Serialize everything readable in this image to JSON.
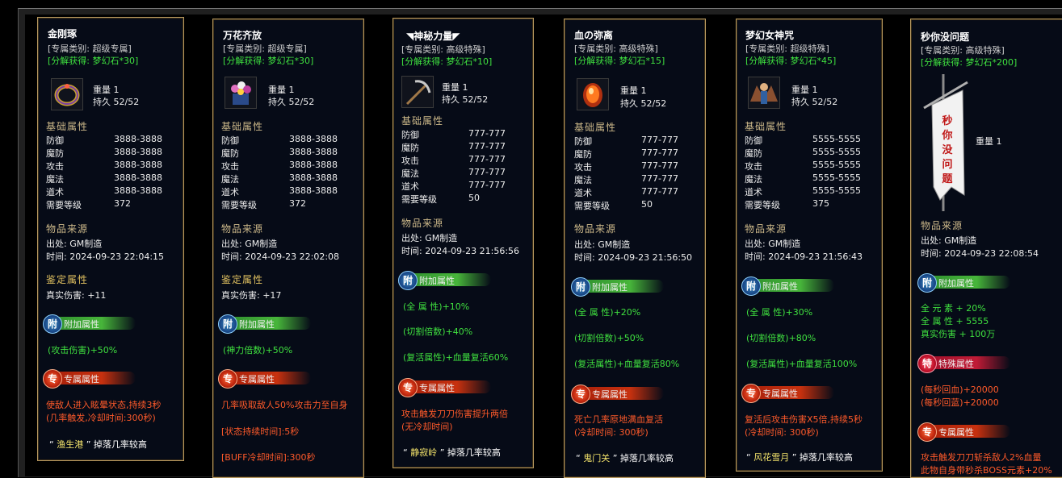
{
  "labels": {
    "weight": "重量",
    "durability": "持久",
    "base_attrs": "基础属性",
    "source_section": "物品来源",
    "identify_section": "鉴定属性",
    "defense": "防御",
    "magic_defense": "魔防",
    "attack": "攻击",
    "magic": "魔法",
    "tao": "道术",
    "required_level": "需要等级",
    "origin": "出处:",
    "time": "时间:",
    "badge_extra": "附加属性",
    "badge_exclusive": "专属属性",
    "badge_special": "特殊属性",
    "badge_glyph_extra": "附",
    "badge_glyph_exclusive": "专",
    "badge_glyph_special": "特"
  },
  "items": [
    {
      "name": "金刚琢",
      "category": "[专属类别: 超级专属]",
      "decompose": "[分解获得: 梦幻石*30]",
      "weight": "1",
      "durability": "52/52",
      "icon": "ring-icon",
      "defense": "3888-3888",
      "magic_defense": "3888-3888",
      "attack": "3888-3888",
      "magic": "3888-3888",
      "tao": "3888-3888",
      "level": "372",
      "origin": "GM制造",
      "time": "2024-09-23 22:04:15",
      "identify": "真实伤害: +11",
      "extras": [
        "(攻击伤害)+50%"
      ],
      "exclusive": [
        "使敌人进入眩晕状态,持续3秒",
        "(几率触发,冷却时间:300秒)"
      ],
      "drop_place": "渔生港",
      "drop_suffix": "掉落几率较高"
    },
    {
      "name": "万花齐放",
      "category": "[专属类别: 超级专属]",
      "decompose": "[分解获得: 梦幻石*30]",
      "weight": "1",
      "durability": "52/52",
      "icon": "flower-basket-icon",
      "defense": "3888-3888",
      "magic_defense": "3888-3888",
      "attack": "3888-3888",
      "magic": "3888-3888",
      "tao": "3888-3888",
      "level": "372",
      "origin": "GM制造",
      "time": "2024-09-23 22:02:08",
      "identify": "真实伤害: +17",
      "extras": [
        "(神力倍数)+50%"
      ],
      "exclusive": [
        "几率吸取敌人50%攻击力至自身",
        "[状态持续时间]:5秒",
        "[BUFF冷却时间]:300秒"
      ]
    },
    {
      "name": "神秘力量",
      "category": "[专属类别: 高级特殊]",
      "decompose": "[分解获得: 梦幻石*10]",
      "weight": "1",
      "durability": "52/52",
      "icon": "pickaxe-icon",
      "defense": "777-777",
      "magic_defense": "777-777",
      "attack": "777-777",
      "magic": "777-777",
      "tao": "777-777",
      "level": "50",
      "origin": "GM制造",
      "time": "2024-09-23 21:56:56",
      "extras": [
        "(全 属 性)+10%",
        "(切割倍数)+40%",
        "(复活属性)+血量复活60%"
      ],
      "exclusive": [
        "攻击触发刀刀伤害提升两倍",
        "(无冷却时间)"
      ],
      "drop_place": "静寂岭",
      "drop_suffix": "掉落几率较高"
    },
    {
      "name": "血の弥离",
      "category": "[专属类别: 高级特殊]",
      "decompose": "[分解获得: 梦幻石*15]",
      "weight": "1",
      "durability": "52/52",
      "icon": "blood-gem-icon",
      "defense": "777-777",
      "magic_defense": "777-777",
      "attack": "777-777",
      "magic": "777-777",
      "tao": "777-777",
      "level": "50",
      "origin": "GM制造",
      "time": "2024-09-23 21:56:50",
      "extras": [
        "(全 属 性)+20%",
        "(切割倍数)+50%",
        "(复活属性)+血量复活80%"
      ],
      "exclusive": [
        "死亡几率原地满血复活",
        "(冷却时间: 300秒)"
      ],
      "drop_place": "鬼门关",
      "drop_suffix": "掉落几率较高"
    },
    {
      "name": "梦幻女神咒",
      "category": "[专属类别: 超级特殊]",
      "decompose": "[分解获得: 梦幻石*45]",
      "weight": "1",
      "durability": "52/52",
      "icon": "goddess-icon",
      "defense": "5555-5555",
      "magic_defense": "5555-5555",
      "attack": "5555-5555",
      "magic": "5555-5555",
      "tao": "5555-5555",
      "level": "375",
      "origin": "GM制造",
      "time": "2024-09-23 21:56:43",
      "extras": [
        "(全 属 性)+30%",
        "(切割倍数)+80%",
        "(复活属性)+血量复活100%"
      ],
      "exclusive": [
        "复活后攻击伤害X5倍,持续5秒",
        "(冷却时间: 300秒)"
      ],
      "drop_place": "风花雪月",
      "drop_suffix": "掉落几率较高"
    },
    {
      "name": "秒你没问题",
      "category": "[专属类别: 高级特殊]",
      "decompose": "[分解获得: 梦幻石*200]",
      "weight": "1",
      "icon": "banner-icon",
      "banner_text": "秒你没问题",
      "origin": "GM制造",
      "time": "2024-09-23 22:08:54",
      "extras": [
        "全 元 素 + 20%",
        "全 属 性 + 5555",
        "真实伤害 + 100万"
      ],
      "special": [
        "(每秒回血)+20000",
        "(每秒回蓝)+20000"
      ],
      "exclusive": [
        "攻击触发刀刀斩杀敌人2%血量",
        "此物自身带秒杀BOSS元素+20%"
      ]
    }
  ]
}
